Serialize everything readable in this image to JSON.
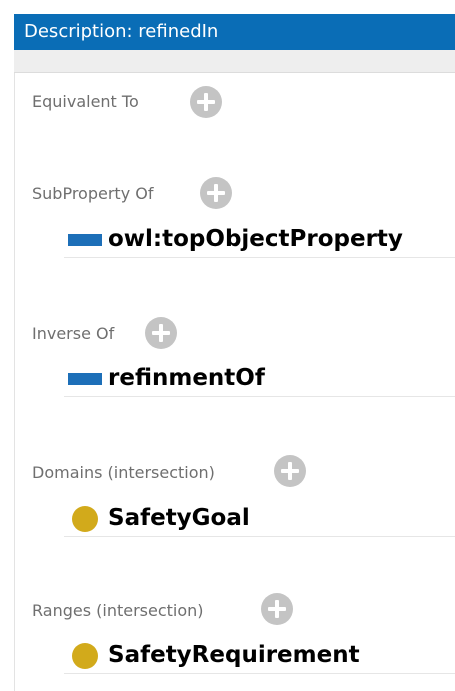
{
  "header": {
    "title": "Description: refinedIn"
  },
  "sections": {
    "equivalent_to": {
      "label": "Equivalent To"
    },
    "subproperty_of": {
      "label": "SubProperty Of",
      "items": [
        {
          "text": "owl:topObjectProperty",
          "icon": "object-property-icon"
        }
      ]
    },
    "inverse_of": {
      "label": "Inverse Of",
      "items": [
        {
          "text": "refinmentOf",
          "icon": "object-property-icon"
        }
      ]
    },
    "domains": {
      "label": "Domains (intersection)",
      "items": [
        {
          "text": "SafetyGoal",
          "icon": "class-icon"
        }
      ]
    },
    "ranges": {
      "label": "Ranges (intersection)",
      "items": [
        {
          "text": "SafetyRequirement",
          "icon": "class-icon"
        }
      ]
    }
  },
  "colors": {
    "header_bg": "#0a6db6",
    "property_icon": "#1d6fb8",
    "class_icon": "#d2aa1b",
    "add_button": "#c4c4c4"
  }
}
